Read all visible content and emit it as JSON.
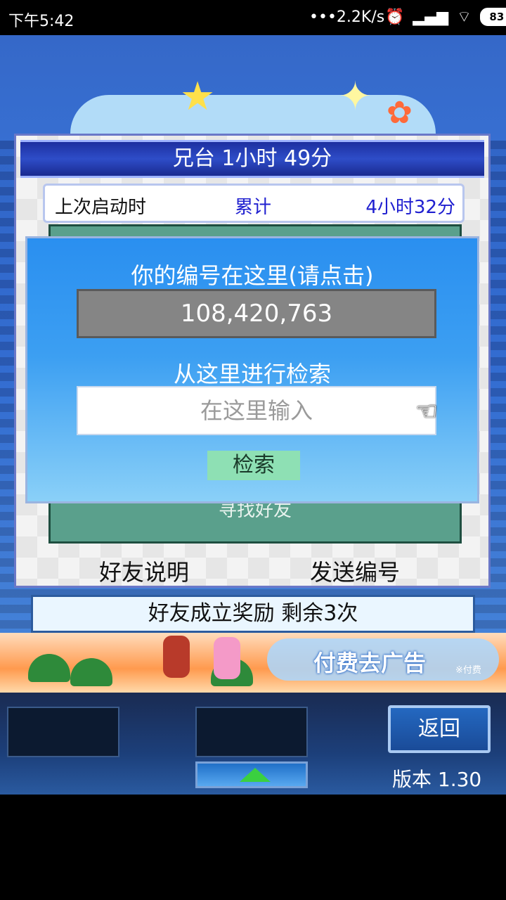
{
  "status_bar": {
    "time": "下午5:42",
    "network_speed": "•••2.2K/s",
    "battery": "83"
  },
  "panel": {
    "title": "兄台  1小时 49分",
    "stat_label": "上次启动时",
    "stat_middle": "累计",
    "stat_value": "4小时32分",
    "find_friend_partial": "寻找好友",
    "friend_info_link": "好友说明",
    "send_id_link": "发送编号"
  },
  "dialog": {
    "heading": "你的编号在这里(请点击)",
    "id_value": "108,420,763",
    "search_heading": "从这里进行检索",
    "search_placeholder": "在这里输入",
    "search_button": "检索"
  },
  "reward_bar": {
    "text": "好友成立奖励  剩余3次"
  },
  "ad": {
    "label": "付费去广告",
    "note": "※付费"
  },
  "bottom_bar": {
    "back_button": "返回",
    "version": "版本 1.30"
  }
}
